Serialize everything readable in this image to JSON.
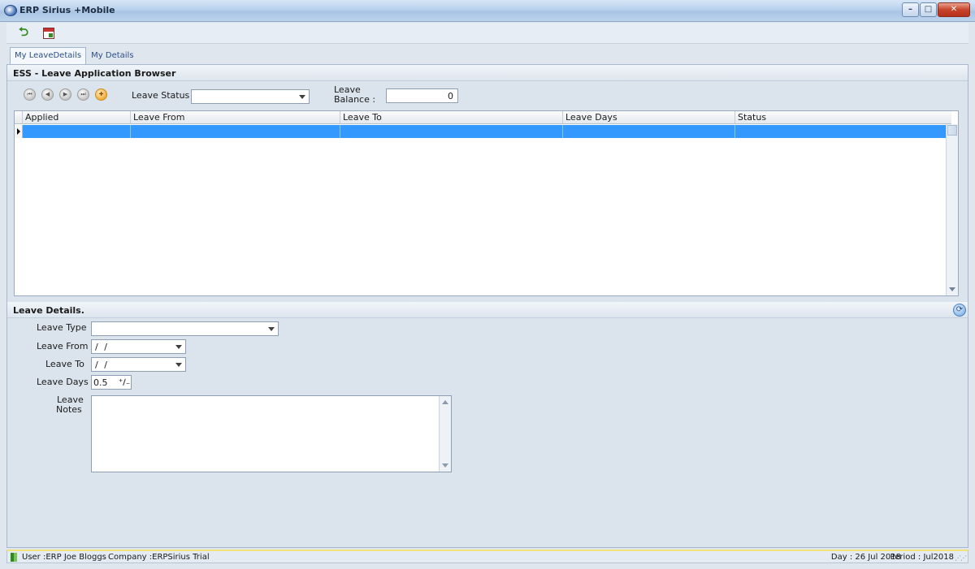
{
  "window": {
    "title": "ERP Sirius +Mobile",
    "minimize_glyph": "–",
    "maximize_glyph": "□",
    "close_glyph": "✕"
  },
  "toolbar": {
    "refresh_icon": "green-return-arrow",
    "calendar_icon": "calendar-icon"
  },
  "tabs": [
    {
      "label": "My LeaveDetails",
      "active": true
    },
    {
      "label": "My Details",
      "active": false
    }
  ],
  "browser": {
    "title": "ESS - Leave Application Browser",
    "nav_icons": [
      "first-record",
      "previous-record",
      "next-record",
      "last-record",
      "add-record"
    ],
    "leave_status_label": "Leave Status",
    "leave_status_value": "",
    "leave_balance_label_line1": "Leave",
    "leave_balance_label_line2": "Balance :",
    "leave_balance_value": "0",
    "columns": [
      "Applied",
      "Leave From",
      "Leave To",
      "Leave Days",
      "Status"
    ],
    "rows": [
      {
        "applied": "",
        "leave_from": "",
        "leave_to": "",
        "leave_days": "",
        "status": "",
        "selected": true
      }
    ]
  },
  "details": {
    "title": "Leave Details.",
    "leave_type_label": "Leave Type",
    "leave_type_value": "",
    "leave_from_label": "Leave From",
    "leave_from_value": " /  /",
    "leave_to_label": "Leave To",
    "leave_to_value": " /  /",
    "leave_days_label": "Leave Days",
    "leave_days_value": "0.5",
    "leave_notes_label_line1": "Leave",
    "leave_notes_label_line2": "Notes",
    "leave_notes_value": ""
  },
  "statusbar": {
    "user": "User :ERP Joe Bloggs",
    "company": "Company :ERPSirius Trial",
    "day": "Day : 26 Jul 2018",
    "period": "Period : Jul2018"
  }
}
